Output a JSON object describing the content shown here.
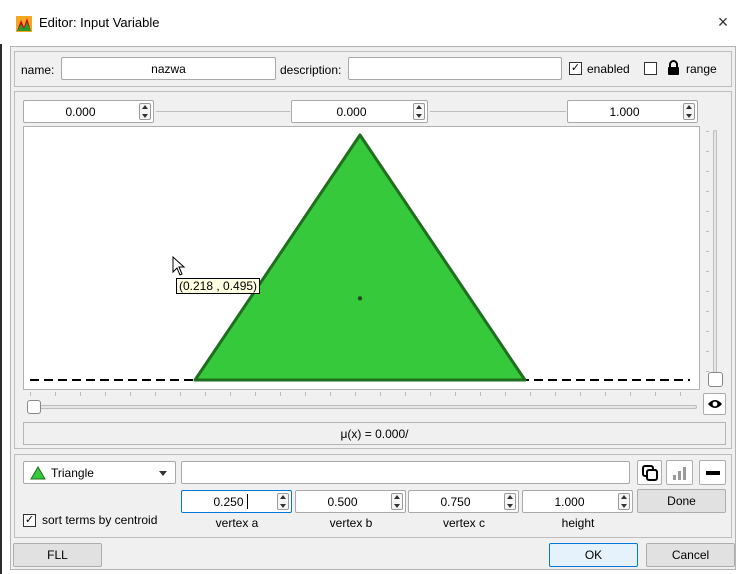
{
  "window": {
    "title": "Editor: Input Variable",
    "close_glyph": "×"
  },
  "header": {
    "name_label": "name:",
    "name_value": "nazwa",
    "description_label": "description:",
    "description_value": "",
    "enabled_label": "enabled",
    "enabled_checked": true,
    "range_checked": false,
    "range_label": "range",
    "check_glyph": "✓"
  },
  "range": {
    "min_value": "0.000",
    "mid_value": "0.000",
    "max_value": "1.000"
  },
  "plot": {
    "tooltip": "(0.218 , 0.495)",
    "mu_readout": "μ(x) = 0.000/",
    "term": {
      "type": "triangle",
      "a": 0.25,
      "b": 0.5,
      "c": 0.75,
      "height": 1.0
    },
    "x_range": [
      0,
      1
    ],
    "fill_color": "#36c93c",
    "stroke_color": "#1f6f1f",
    "slider_level": 0.0
  },
  "term_editor": {
    "term_type": "Triangle",
    "term_expression": "",
    "sort_label": "sort terms by centroid",
    "sort_checked": true,
    "params": [
      {
        "value": "0.250",
        "label": "vertex a"
      },
      {
        "value": "0.500",
        "label": "vertex b"
      },
      {
        "value": "0.750",
        "label": "vertex c"
      },
      {
        "value": "1.000",
        "label": "height"
      }
    ],
    "done_label": "Done"
  },
  "footer": {
    "fll_label": "FLL",
    "ok_label": "OK",
    "cancel_label": "Cancel"
  },
  "icons": [
    "app-icon",
    "lock-icon",
    "eye-icon",
    "copy-icon",
    "bar-chart-icon",
    "minus-icon",
    "triangle-term-icon",
    "mouse-cursor-icon"
  ]
}
